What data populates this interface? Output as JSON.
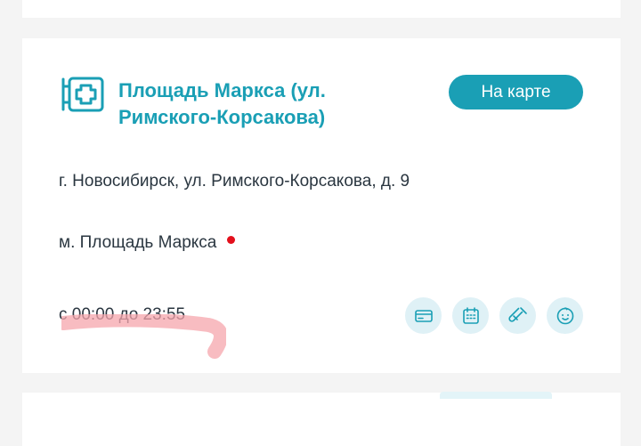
{
  "clinic": {
    "title": "Площадь Маркса (ул. Римского-Корсакова)",
    "map_button_label": "На карте",
    "address": "г. Новосибирск, ул. Римского-Корсакова, д. 9",
    "metro": "м. Площадь Маркса",
    "hours": "с 00:00 до 23:55",
    "features": [
      {
        "icon": "card-payment-icon"
      },
      {
        "icon": "calendar-icon"
      },
      {
        "icon": "test-tube-icon"
      },
      {
        "icon": "child-face-icon"
      }
    ]
  },
  "colors": {
    "accent": "#1a9fb5",
    "metro_line": "#e3101c",
    "icon_bg": "#dff1f6",
    "text": "#2a3640",
    "background": "#f4f4f4"
  }
}
